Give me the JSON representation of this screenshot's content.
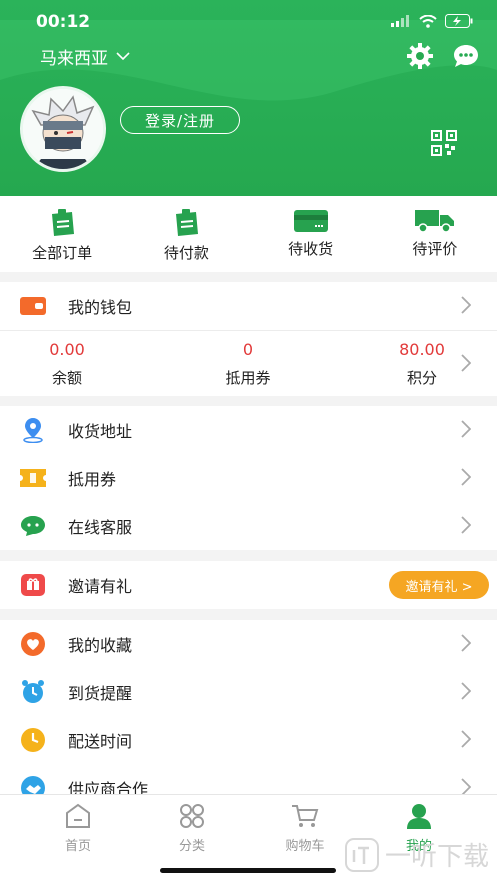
{
  "status": {
    "time": "00:12"
  },
  "header": {
    "region": "马来西亚",
    "login_label": "登录/注册"
  },
  "orders": [
    {
      "label": "全部订单",
      "icon": "clipboard-icon"
    },
    {
      "label": "待付款",
      "icon": "clipboard-icon"
    },
    {
      "label": "待收货",
      "icon": "card-icon"
    },
    {
      "label": "待评价",
      "icon": "truck-icon"
    }
  ],
  "wallet": {
    "title": "我的钱包",
    "stats": [
      {
        "value": "0.00",
        "label": "余额"
      },
      {
        "value": "0",
        "label": "抵用券"
      },
      {
        "value": "80.00",
        "label": "积分"
      }
    ]
  },
  "menu1": [
    {
      "label": "收货地址",
      "icon": "location-pin-icon"
    },
    {
      "label": "抵用券",
      "icon": "coupon-icon"
    },
    {
      "label": "在线客服",
      "icon": "chat-bubble-icon"
    }
  ],
  "invite": {
    "label": "邀请有礼",
    "button": "邀请有礼 >"
  },
  "menu2": [
    {
      "label": "我的收藏",
      "icon": "heart-icon"
    },
    {
      "label": "到货提醒",
      "icon": "alarm-clock-icon"
    },
    {
      "label": "配送时间",
      "icon": "clock-icon"
    },
    {
      "label": "供应商合作",
      "icon": "handshake-icon"
    }
  ],
  "tabbar": [
    {
      "label": "首页",
      "icon": "home-icon",
      "active": false
    },
    {
      "label": "分类",
      "icon": "category-icon",
      "active": false
    },
    {
      "label": "购物车",
      "icon": "cart-icon",
      "active": false
    },
    {
      "label": "我的",
      "icon": "profile-icon",
      "active": true
    }
  ],
  "watermark": "一听下载",
  "colors": {
    "brand_green": "#25a84f",
    "price_red": "#e23a3a",
    "invite_orange": "#f5a623"
  }
}
